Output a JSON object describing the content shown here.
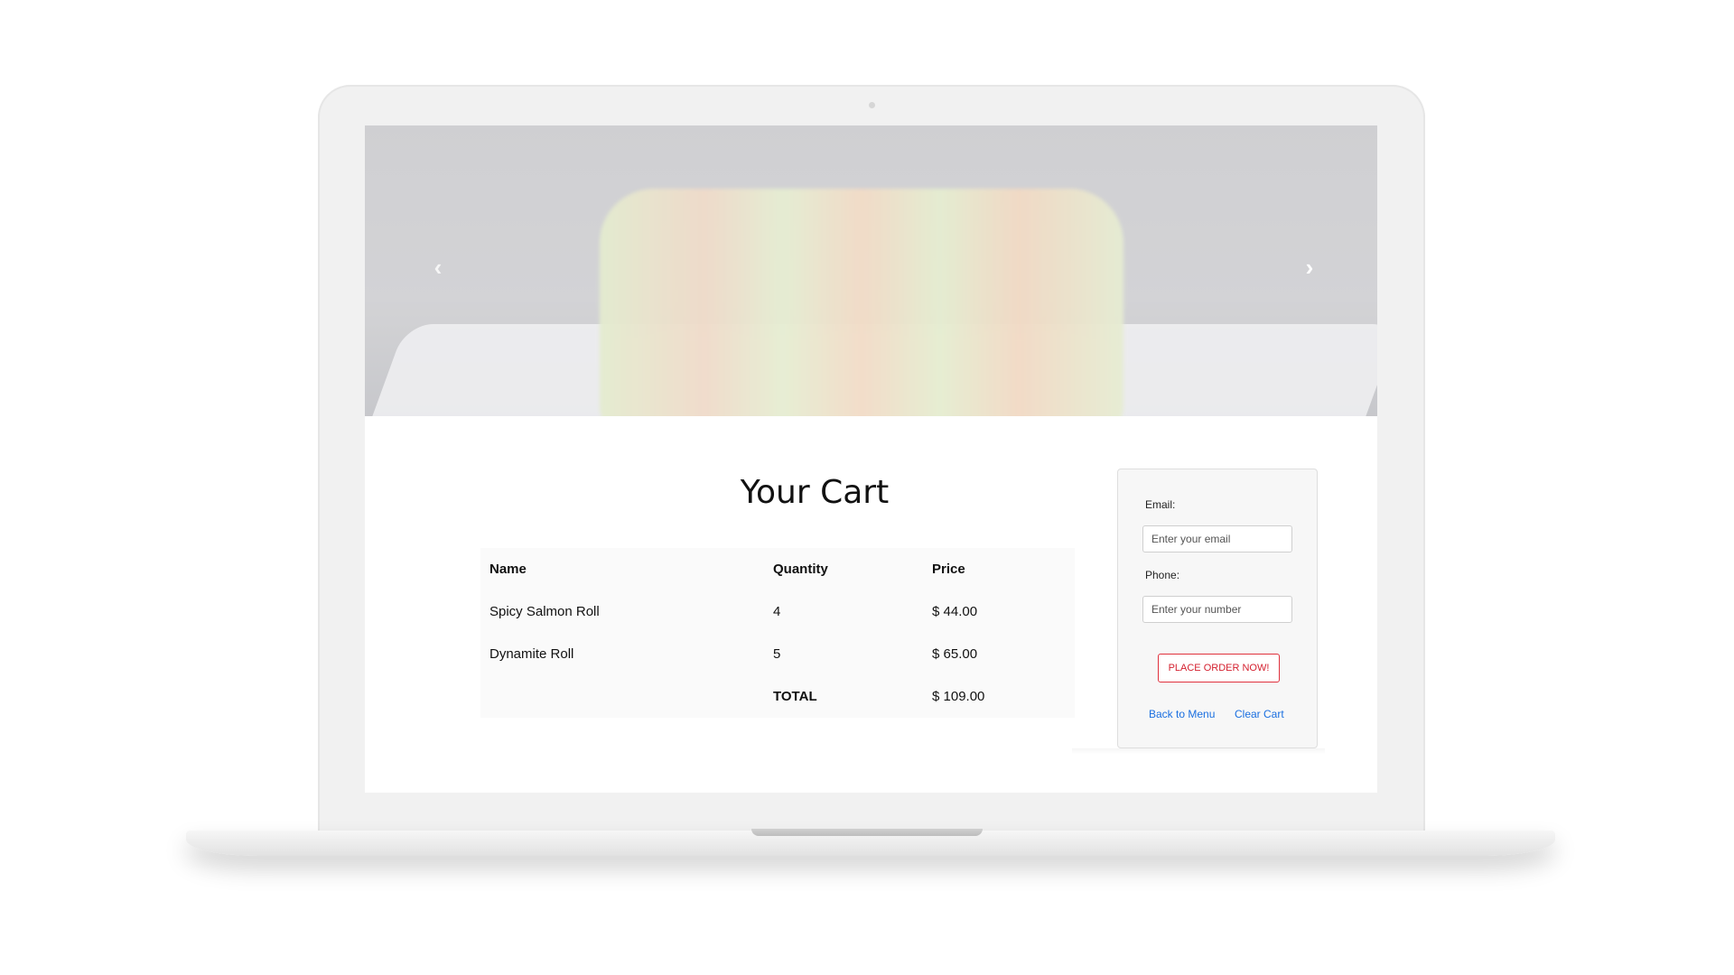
{
  "carousel": {
    "prev_icon": "chevron-left-icon",
    "next_icon": "chevron-right-icon",
    "prev_glyph": "‹",
    "next_glyph": "›"
  },
  "cart": {
    "title": "Your Cart",
    "columns": [
      "Name",
      "Quantity",
      "Price"
    ],
    "rows": [
      {
        "name": "Spicy Salmon Roll",
        "quantity": "4",
        "price": "$ 44.00"
      },
      {
        "name": "Dynamite Roll",
        "quantity": "5",
        "price": "$ 65.00"
      }
    ],
    "total_label": "TOTAL",
    "total_price": "$ 109.00"
  },
  "order_form": {
    "email_label": "Email:",
    "email_placeholder": "Enter your email",
    "phone_label": "Phone:",
    "phone_placeholder": "Enter your number",
    "submit_label": "PLACE ORDER NOW!",
    "back_link": "Back to Menu",
    "clear_link": "Clear Cart"
  },
  "colors": {
    "accent_red": "#d41f2e",
    "link_blue": "#1a6fe0"
  }
}
